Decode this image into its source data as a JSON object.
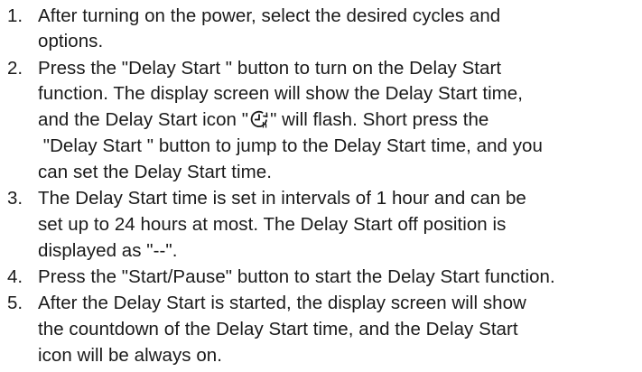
{
  "steps": [
    {
      "number": "1.",
      "lines": [
        "After turning on the power, select the desired cycles and",
        "options."
      ]
    },
    {
      "number": "2.",
      "lines": [
        "Press the \"Delay Start \" button to turn on the Delay Start",
        "function. The display screen will show the Delay Start time,",
        "and the Delay Start icon \"",
        "\" will flash. Short press the",
        " \"Delay Start \" button to jump to the Delay Start time, and you",
        "can set the Delay Start time."
      ]
    },
    {
      "number": "3.",
      "lines": [
        "The Delay Start time is set in intervals of 1 hour and can be",
        "set up to 24 hours at most. The Delay Start off position is",
        "displayed as \"--\"."
      ]
    },
    {
      "number": "4.",
      "lines": [
        "Press the \"Start/Pause\" button to start the Delay Start function."
      ]
    },
    {
      "number": "5.",
      "lines": [
        "After the Delay Start is started, the display screen will show",
        "the countdown of the Delay Start time, and the Delay Start",
        "icon will be always on."
      ]
    }
  ],
  "icon": "delay-start-icon"
}
